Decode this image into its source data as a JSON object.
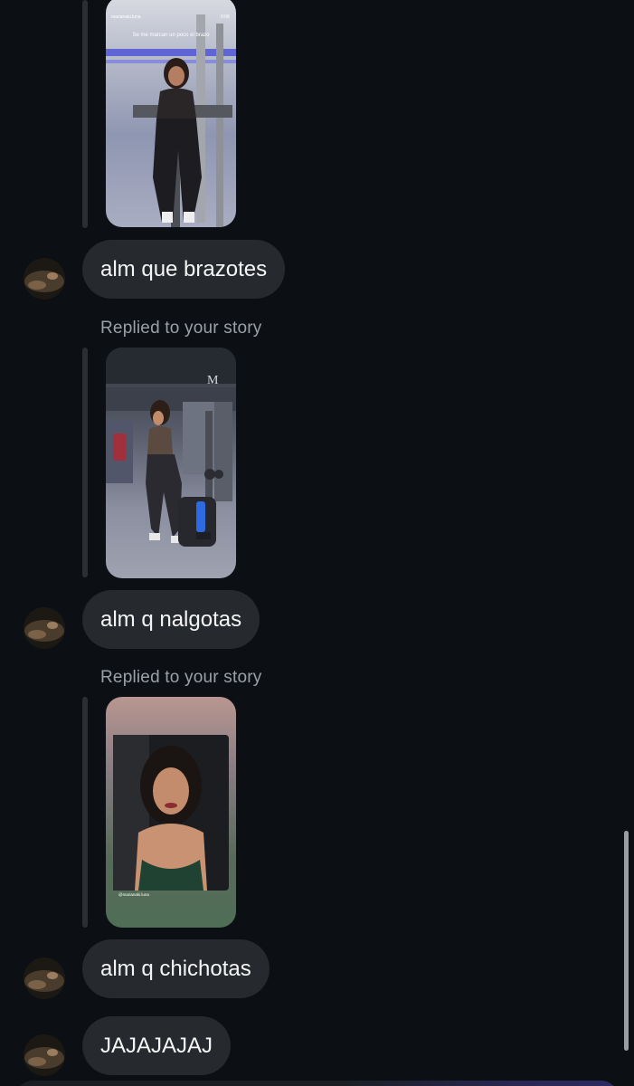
{
  "conversation": {
    "replied_label": "Replied to your story",
    "messages": [
      {
        "type": "story_reply",
        "text": "alm que brazotes",
        "story_caption": "marianaki.luna",
        "story_overlay": "Se me marcan un poco el brazo",
        "story_time": "0:08"
      },
      {
        "type": "story_reply",
        "text": "alm q nalgotas"
      },
      {
        "type": "story_reply",
        "text": "alm q chichotas",
        "story_caption": "@marianaki.luna"
      },
      {
        "type": "text",
        "text": "JAJAJAJAJ"
      }
    ]
  },
  "colors": {
    "background": "#0c1014",
    "bubble": "#262a2e",
    "reply_line": "#2b2f33",
    "label": "#9aa0a6",
    "text": "#f5f5f5"
  },
  "icons": {
    "avatar": "profile-photo"
  }
}
